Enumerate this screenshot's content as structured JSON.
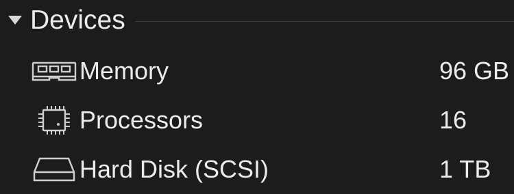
{
  "section": {
    "title": "Devices",
    "expanded": true,
    "caret_icon": "caret-down-icon"
  },
  "devices": [
    {
      "icon": "memory-icon",
      "name": "Memory",
      "value": "96 GB"
    },
    {
      "icon": "processor-icon",
      "name": "Processors",
      "value": "16"
    },
    {
      "icon": "hard-disk-icon",
      "name": "Hard Disk (SCSI)",
      "value": "1 TB"
    }
  ],
  "colors": {
    "background": "#1c1c1c",
    "text": "#ececec",
    "icon": "#cfcfcf",
    "divider": "#3c3c3c"
  }
}
